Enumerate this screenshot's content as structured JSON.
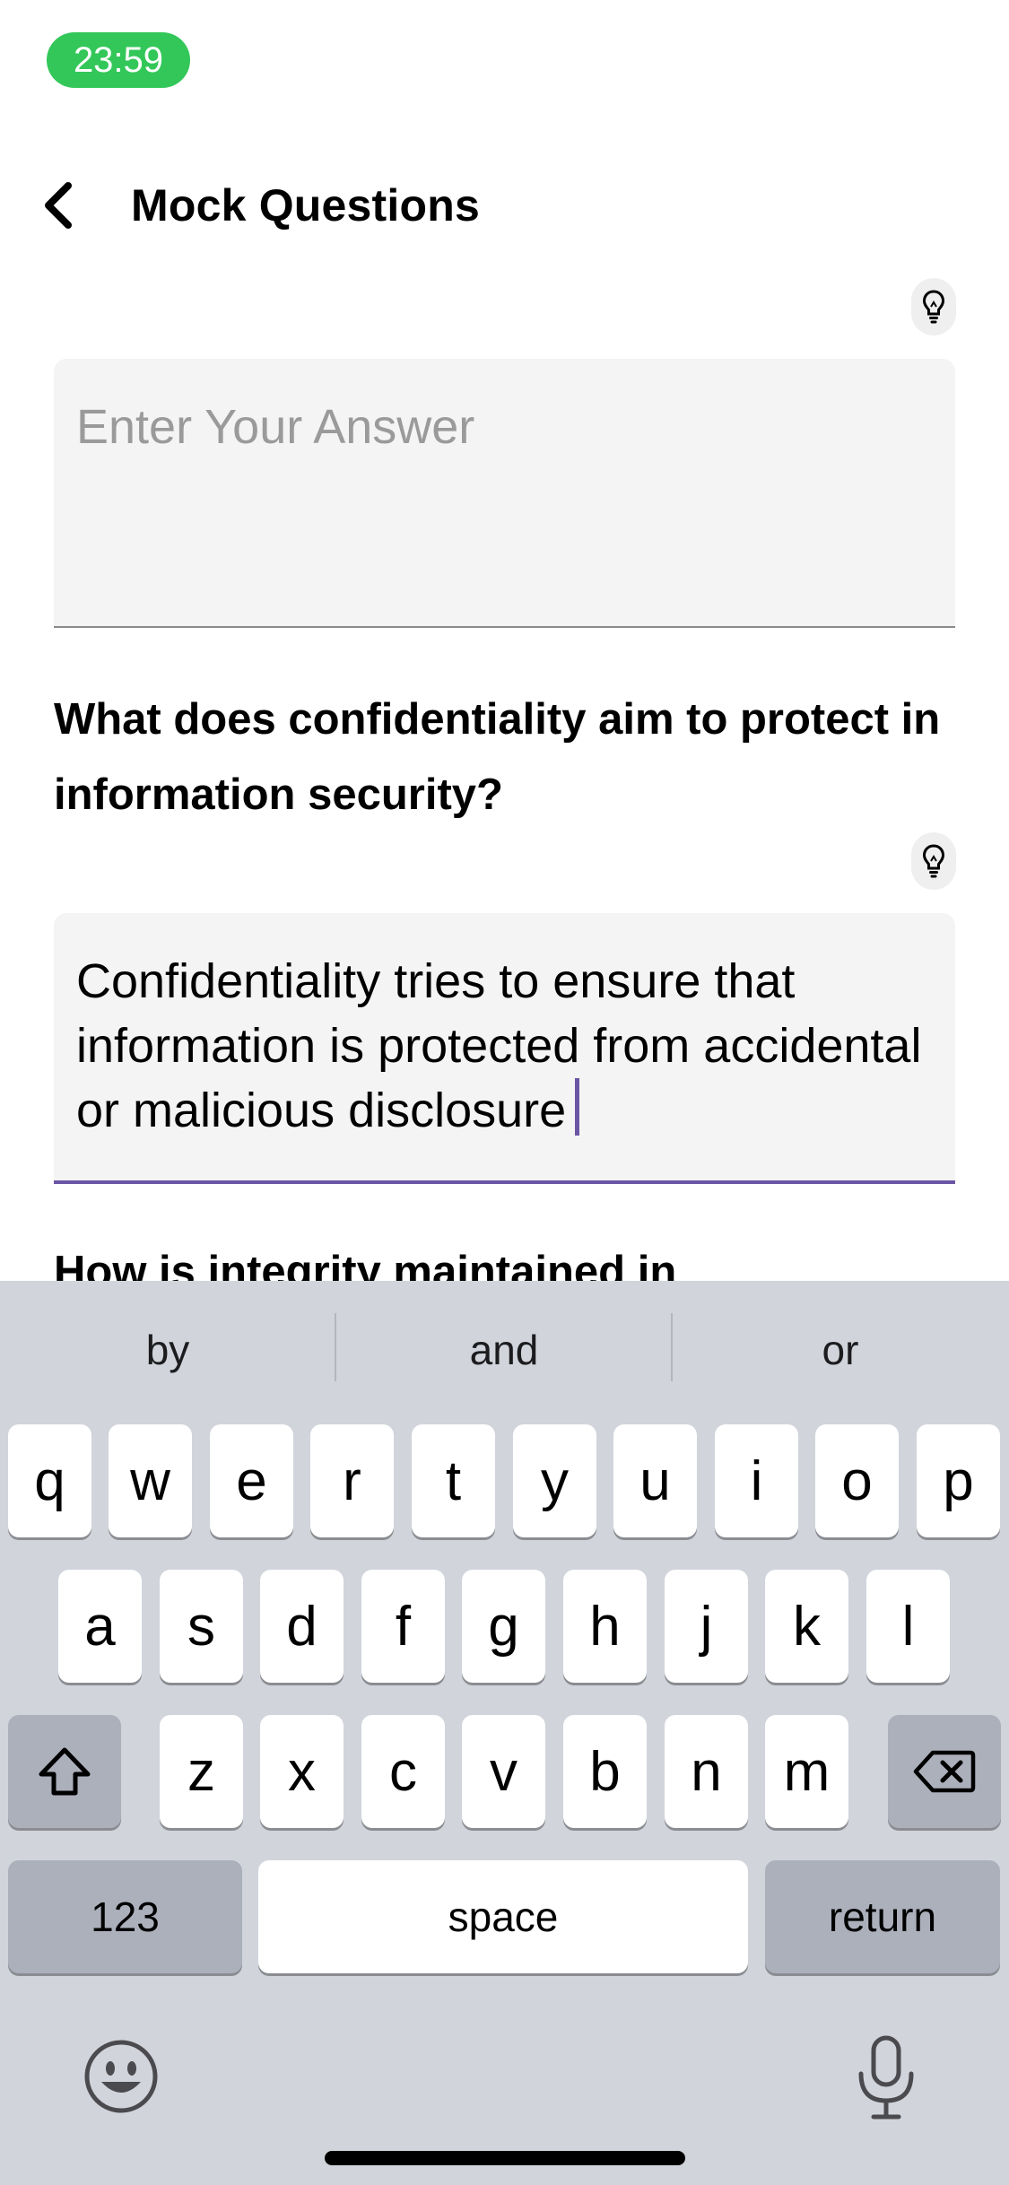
{
  "status_bar": {
    "time": "23:59",
    "time_badge_color": "#33c759"
  },
  "nav": {
    "back_icon": "chevron-left-icon",
    "title": "Mock Questions"
  },
  "hint_icon": "lightbulb-icon",
  "answers": [
    {
      "value": "",
      "placeholder": "Enter Your Answer"
    },
    {
      "value": "Confidentiality tries to ensure that information is protected from accidental or malicious disclosure",
      "placeholder": "Enter Your Answer"
    }
  ],
  "questions": [
    {
      "text": "What does confidentiality aim to protect in information security?"
    },
    {
      "text": "How is integrity maintained in"
    }
  ],
  "accent_color": "#6a55a4",
  "keyboard": {
    "suggestions": [
      "by",
      "and",
      "or"
    ],
    "row1": [
      "q",
      "w",
      "e",
      "r",
      "t",
      "y",
      "u",
      "i",
      "o",
      "p"
    ],
    "row2": [
      "a",
      "s",
      "d",
      "f",
      "g",
      "h",
      "j",
      "k",
      "l"
    ],
    "row3": [
      "z",
      "x",
      "c",
      "v",
      "b",
      "n",
      "m"
    ],
    "numbers_label": "123",
    "space_label": "space",
    "return_label": "return",
    "shift_icon": "shift-icon",
    "delete_icon": "delete-backspace-icon",
    "emoji_icon": "emoji-icon",
    "mic_icon": "microphone-icon"
  }
}
